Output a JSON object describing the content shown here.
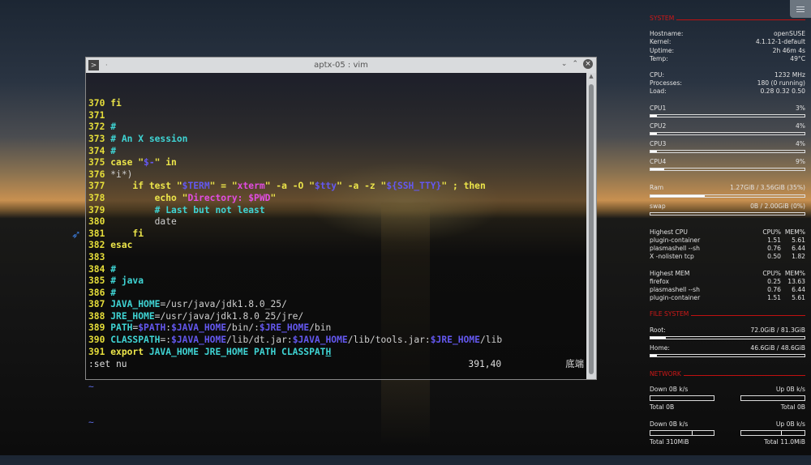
{
  "window": {
    "title": "aptx-05 : vim",
    "icon": "terminal-icon",
    "pin": "·"
  },
  "editor": {
    "lines": [
      {
        "n": "370",
        "segs": [
          [
            "fi",
            "y"
          ]
        ]
      },
      {
        "n": "371",
        "segs": []
      },
      {
        "n": "372",
        "segs": [
          [
            "#",
            "c"
          ]
        ]
      },
      {
        "n": "373",
        "segs": [
          [
            "# An X session",
            "c"
          ]
        ]
      },
      {
        "n": "374",
        "segs": [
          [
            "#",
            "c"
          ]
        ]
      },
      {
        "n": "375",
        "segs": [
          [
            "case \"",
            "y"
          ],
          [
            "$-",
            "b"
          ],
          [
            "\" in",
            "y"
          ]
        ]
      },
      {
        "n": "376",
        "segs": [
          [
            "*i*)",
            "w"
          ]
        ]
      },
      {
        "n": "377",
        "segs": [
          [
            "    if test \"",
            "y"
          ],
          [
            "$TERM",
            "b"
          ],
          [
            "\" = \"",
            "y"
          ],
          [
            "xterm",
            "m"
          ],
          [
            "\" -a -O \"",
            "y"
          ],
          [
            "$tty",
            "b"
          ],
          [
            "\" -a -z \"",
            "y"
          ],
          [
            "${SSH_TTY}",
            "b"
          ],
          [
            "\" ; then",
            "y"
          ]
        ]
      },
      {
        "n": "378",
        "segs": [
          [
            "        echo \"",
            "y"
          ],
          [
            "Directory: $PWD",
            "m"
          ],
          [
            "\"",
            "y"
          ]
        ]
      },
      {
        "n": "379",
        "segs": [
          [
            "        # Last but not least",
            "c"
          ]
        ]
      },
      {
        "n": "380",
        "segs": [
          [
            "        date",
            "w"
          ]
        ]
      },
      {
        "n": "381",
        "segs": [
          [
            "    fi",
            "y"
          ]
        ]
      },
      {
        "n": "382",
        "segs": [
          [
            "esac",
            "y"
          ]
        ]
      },
      {
        "n": "383",
        "segs": []
      },
      {
        "n": "384",
        "segs": [
          [
            "#",
            "c"
          ]
        ]
      },
      {
        "n": "385",
        "segs": [
          [
            "# java",
            "c"
          ]
        ]
      },
      {
        "n": "386",
        "segs": [
          [
            "#",
            "c"
          ]
        ]
      },
      {
        "n": "387",
        "segs": [
          [
            "JAVA_HOME",
            "c"
          ],
          [
            "=/usr/java/jdk1.8.0_25/",
            "w"
          ]
        ]
      },
      {
        "n": "388",
        "segs": [
          [
            "JRE_HOME",
            "c"
          ],
          [
            "=/usr/java/jdk1.8.0_25/jre/",
            "w"
          ]
        ]
      },
      {
        "n": "389",
        "segs": [
          [
            "PATH",
            "c"
          ],
          [
            "=",
            "w"
          ],
          [
            "$PATH",
            "b"
          ],
          [
            ":",
            "w"
          ],
          [
            "$JAVA_HOME",
            "b"
          ],
          [
            "/bin/:",
            "w"
          ],
          [
            "$JRE_HOME",
            "b"
          ],
          [
            "/bin",
            "w"
          ]
        ]
      },
      {
        "n": "390",
        "segs": [
          [
            "CLASSPATH",
            "c"
          ],
          [
            "=:",
            "w"
          ],
          [
            "$JAVA_HOME",
            "b"
          ],
          [
            "/lib/dt.jar:",
            "w"
          ],
          [
            "$JAVA_HOME",
            "b"
          ],
          [
            "/lib/tools.jar:",
            "w"
          ],
          [
            "$JRE_HOME",
            "b"
          ],
          [
            "/lib",
            "w"
          ]
        ]
      },
      {
        "n": "391",
        "segs": [
          [
            "export ",
            "y"
          ],
          [
            "JAVA_HOME JRE_HOME PATH CLASSPAT",
            "c"
          ],
          [
            "H",
            "c cur"
          ]
        ]
      }
    ],
    "tilde": "~",
    "command": ":set nu",
    "position": "391,40",
    "scroll_pos": "底端"
  },
  "conky": {
    "system_header": "SYSTEM",
    "info": [
      [
        "Hostname:",
        "openSUSE"
      ],
      [
        "Kernel:",
        "4.1.12-1-default"
      ],
      [
        "Uptime:",
        "2h 46m 4s"
      ],
      [
        "Temp:",
        "49°C"
      ]
    ],
    "cpuinfo": [
      [
        "CPU:",
        "1232 MHz"
      ],
      [
        "Processes:",
        "180 (0 running)"
      ],
      [
        "Load:",
        "0.28 0.32 0.50"
      ]
    ],
    "cpus": [
      {
        "label": "CPU1",
        "value": "3%",
        "fill": 0.03
      },
      {
        "label": "CPU2",
        "value": "4%",
        "fill": 0.04
      },
      {
        "label": "CPU3",
        "value": "4%",
        "fill": 0.04
      },
      {
        "label": "CPU4",
        "value": "9%",
        "fill": 0.09
      }
    ],
    "mem": [
      {
        "label": "Ram",
        "value": "1.27GiB / 3.56GiB (35%)",
        "fill": 0.35
      },
      {
        "label": "swap",
        "value": "0B   / 2.00GiB (0%)",
        "fill": 0
      }
    ],
    "highest_cpu": {
      "title": "Highest CPU",
      "c1": "CPU%",
      "c2": "MEM%",
      "rows": [
        [
          "plugin-container",
          "1.51",
          "5.61"
        ],
        [
          "plasmashell --sh",
          "0.76",
          "6.44"
        ],
        [
          "X -nolisten tcp",
          "0.50",
          "1.82"
        ]
      ]
    },
    "highest_mem": {
      "title": "Highest MEM",
      "c1": "CPU%",
      "c2": "MEM%",
      "rows": [
        [
          "firefox",
          "0.25",
          "13.63"
        ],
        [
          "plasmashell --sh",
          "0.76",
          "6.44"
        ],
        [
          "plugin-container",
          "1.51",
          "5.61"
        ]
      ]
    },
    "fs_header": "FILE SYSTEM",
    "fs": [
      {
        "label": "Root:",
        "value": "72.0GiB / 81.3GiB",
        "fill": 0.1
      },
      {
        "label": "Home:",
        "value": "46.6GiB / 48.6GiB",
        "fill": 0.01
      }
    ],
    "net_header": "NETWORK",
    "net": [
      {
        "down": "Down 0B   k/s",
        "up": "Up 0B   k/s",
        "down_total": "Total 0B",
        "up_total": "Total 0B",
        "down_mark": null,
        "up_mark": null
      },
      {
        "down": "Down 0B   k/s",
        "up": "Up 0B   k/s",
        "down_total": "Total 310MiB",
        "up_total": "Total 11.0MiB",
        "down_mark": 0.65,
        "up_mark": 0.63
      }
    ]
  }
}
